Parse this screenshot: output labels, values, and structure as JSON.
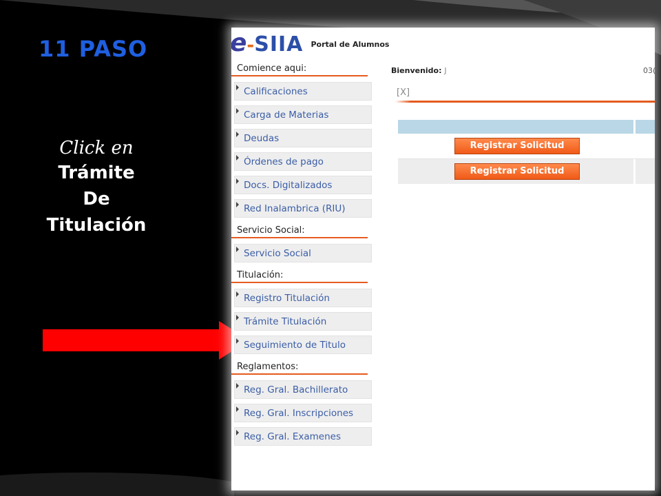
{
  "slide": {
    "title": "11 PASO",
    "instruction": {
      "click": "Click en",
      "line1": "Trámite",
      "line2": "De",
      "line3": "Titulación"
    }
  },
  "portal": {
    "logo_e": "e",
    "logo_dash": "-",
    "logo_name": "SIIA",
    "logo_subtitle": "Portal de Alumnos",
    "welcome_label": "Bienvenido:",
    "welcome_name": "J",
    "welcome_code": "03(",
    "close_label": "[X]",
    "register_button": "Registrar Solicitud"
  },
  "sidebar": {
    "sections": [
      {
        "header": "Comience aqui:",
        "items": [
          "Calificaciones",
          "Carga de Materias",
          "Deudas",
          "Órdenes de pago",
          "Docs. Digitalizados",
          "Red Inalambrica (RIU)"
        ]
      },
      {
        "header": "Servicio Social:",
        "items": [
          "Servicio Social"
        ]
      },
      {
        "header": "Titulación:",
        "items": [
          "Registro Titulación",
          "Trámite Titulación",
          "Seguimiento de Titulo"
        ]
      },
      {
        "header": "Reglamentos:",
        "items": [
          "Reg. Gral. Bachillerato",
          "Reg. Gral. Inscripciones",
          "Reg. Gral. Examenes"
        ]
      }
    ]
  },
  "colors": {
    "title_blue": "#1f5fe0",
    "arrow_red": "#ff0000",
    "accent_orange": "#e55a1e",
    "link_blue": "#3a5da6"
  }
}
